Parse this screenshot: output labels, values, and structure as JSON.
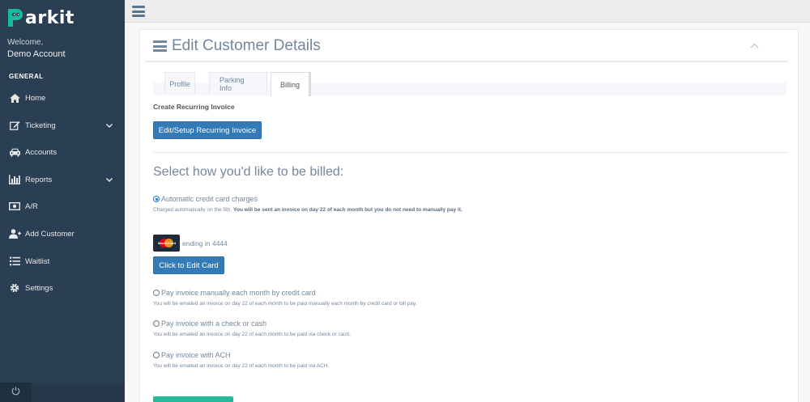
{
  "brand": {
    "name": "arkit",
    "colors": {
      "sidebar": "#2a3f54",
      "primary": "#337ab7",
      "success": "#26b99a",
      "logo": "#1abb9c"
    }
  },
  "user": {
    "welcome": "Welcome,",
    "account": "Demo Account"
  },
  "sidebar": {
    "section": "GENERAL",
    "items": [
      {
        "label": "Home",
        "icon": "home-icon"
      },
      {
        "label": "Ticketing",
        "icon": "edit-icon",
        "has_submenu": true
      },
      {
        "label": "Accounts",
        "icon": "car-icon"
      },
      {
        "label": "Reports",
        "icon": "bar-chart-icon",
        "has_submenu": true
      },
      {
        "label": "A/R",
        "icon": "money-icon"
      },
      {
        "label": "Add Customer",
        "icon": "user-plus-icon"
      },
      {
        "label": "Waitlist",
        "icon": "list-icon"
      },
      {
        "label": "Settings",
        "icon": "gear-icon"
      }
    ]
  },
  "page": {
    "title": "Edit Customer Details"
  },
  "tabs": [
    {
      "label": "Profile",
      "active": false
    },
    {
      "label": "Parking Info",
      "active": false
    },
    {
      "label": "Billing",
      "active": true
    }
  ],
  "billing": {
    "recurring_header": "Create Recurring Invoice",
    "recurring_button": "Edit/Setup Recurring Invoice",
    "billed_header": "Select how you'd like to be billed:",
    "options": [
      {
        "label": "Automatic credit card charges",
        "selected": true,
        "desc_plain": "Charged automatically on the 5th.",
        "desc_bold": "You will be sent an invoice on day 22 of each month but you do not need to manually pay it."
      },
      {
        "label": "Pay invoice manually each month by credit card",
        "selected": false,
        "desc_plain": "You will be emailed an invoice on day 22 of each month to be paid manually each month by credit card or bill pay."
      },
      {
        "label": "Pay invoice with a check or cash",
        "selected": false,
        "desc_plain": "You will be emailed an invoice on day 22 of each month to be paid via check or cash."
      },
      {
        "label": "Pay invoice with ACH",
        "selected": false,
        "desc_plain": "You will be emailed an invoice on day 22 of each month to be paid via ACH."
      }
    ],
    "card": {
      "brand_text": "MasterCard",
      "ending": "ending in 4444"
    },
    "edit_card_button": "Click to Edit Card"
  }
}
